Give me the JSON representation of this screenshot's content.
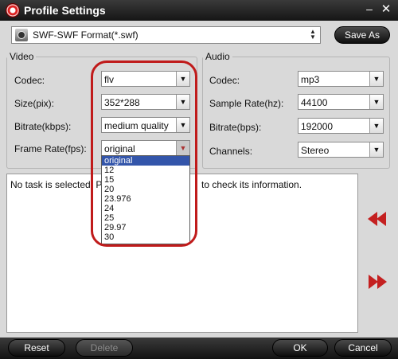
{
  "window": {
    "title": "Profile Settings",
    "minimize_glyph": "–",
    "close_glyph": "✕"
  },
  "profile": {
    "value": "SWF-SWF Format(*.swf)",
    "icon": "film-reel-icon",
    "save_as_label": "Save As"
  },
  "video": {
    "legend": "Video",
    "codec": {
      "label": "Codec:",
      "value": "flv"
    },
    "size": {
      "label": "Size(pix):",
      "value": "352*288"
    },
    "bitrate": {
      "label": "Bitrate(kbps):",
      "value": "medium quality"
    },
    "frame_rate": {
      "label": "Frame Rate(fps):",
      "value": "original",
      "options": [
        "original",
        "12",
        "15",
        "20",
        "23.976",
        "24",
        "25",
        "29.97",
        "30"
      ]
    }
  },
  "audio": {
    "legend": "Audio",
    "codec": {
      "label": "Codec:",
      "value": "mp3"
    },
    "sample_rate": {
      "label": "Sample Rate(hz):",
      "value": "44100"
    },
    "bitrate": {
      "label": "Bitrate(bps):",
      "value": "192000"
    },
    "channels": {
      "label": "Channels:",
      "value": "Stereo"
    }
  },
  "task_info": {
    "text_left": "No task is selected. P",
    "text_right": "to check its information."
  },
  "buttons": {
    "reset": "Reset",
    "delete": "Delete",
    "ok": "OK",
    "cancel": "Cancel"
  },
  "colors": {
    "accent_red": "#c42020",
    "selection_blue": "#3355aa",
    "titlebar": "#1f1f1f"
  }
}
